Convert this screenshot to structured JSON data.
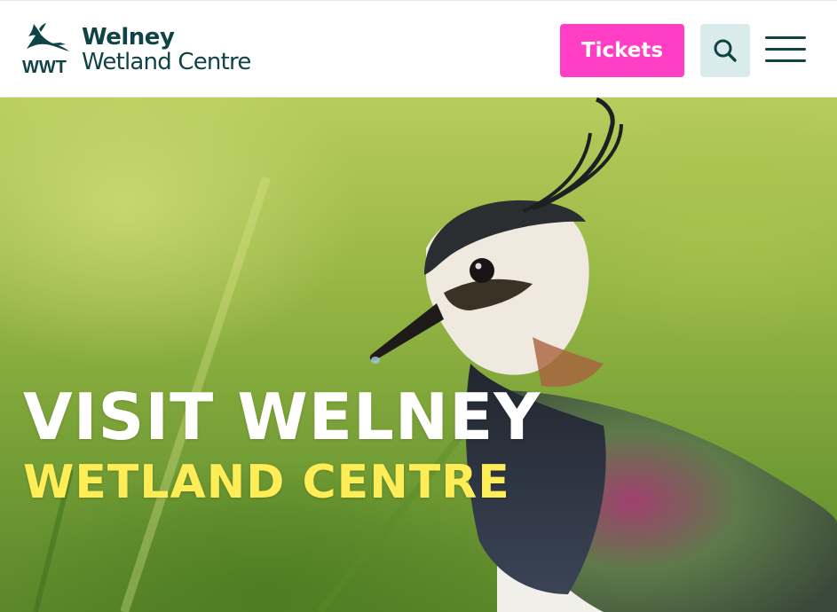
{
  "header": {
    "logo": {
      "abbreviation": "WWT",
      "line1": "Welney",
      "line2": "Wetland Centre",
      "icon": "crane-icon",
      "color": "#0f4346"
    },
    "tickets_label": "Tickets",
    "tickets_color": "#ff3dc5",
    "search_icon": "search-icon",
    "menu_icon": "hamburger-menu-icon"
  },
  "hero": {
    "title_line1": "Visit Welney",
    "title_line2": "Wetland Centre",
    "title_line1_color": "#ffffff",
    "title_line2_color": "#ffed57",
    "image_subject": "lapwing-bird-photo"
  }
}
